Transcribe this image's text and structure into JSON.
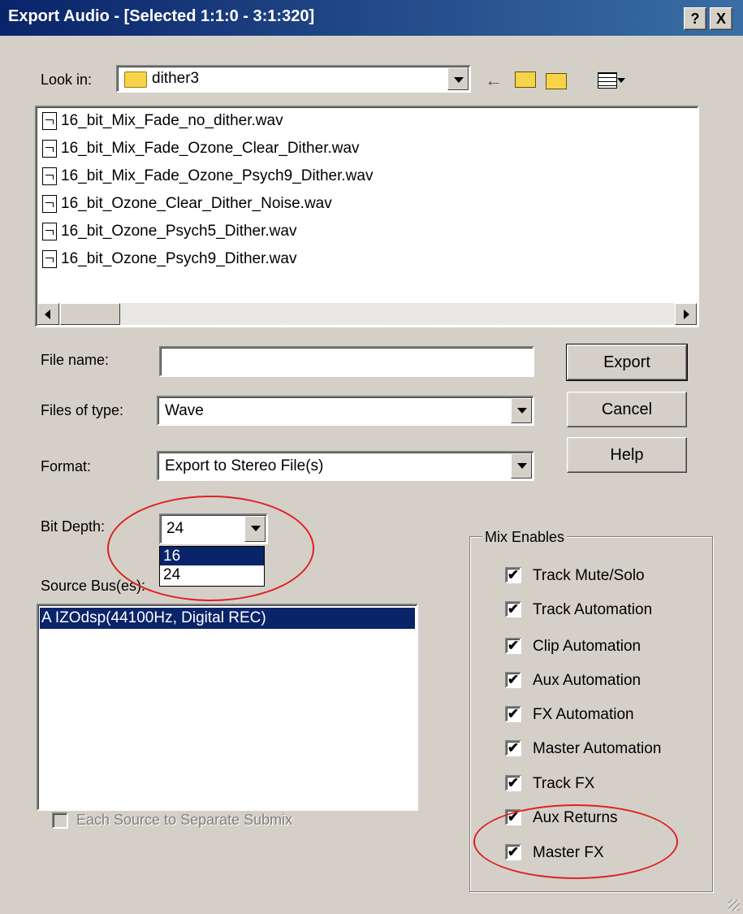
{
  "window": {
    "title": "Export Audio - [Selected 1:1:0 - 3:1:320]",
    "help_btn": "?",
    "close_btn": "X"
  },
  "look_in": {
    "label": "Look in:",
    "value": "dither3"
  },
  "files": [
    "16_bit_Mix_Fade_no_dither.wav",
    "16_bit_Mix_Fade_Ozone_Clear_Dither.wav",
    "16_bit_Mix_Fade_Ozone_Psych9_Dither.wav",
    "16_bit_Ozone_Clear_Dither_Noise.wav",
    "16_bit_Ozone_Psych5_Dither.wav",
    "16_bit_Ozone_Psych9_Dither.wav"
  ],
  "file_name": {
    "label": "File name:",
    "value": ""
  },
  "files_of_type": {
    "label": "Files of type:",
    "value": "Wave"
  },
  "format": {
    "label": "Format:",
    "value": "Export to Stereo File(s)"
  },
  "bit_depth": {
    "label": "Bit Depth:",
    "value": "24",
    "options": [
      "16",
      "24"
    ]
  },
  "source_bus": {
    "label": "Source Bus(es):",
    "items": [
      "A IZOdsp(44100Hz, Digital REC)"
    ]
  },
  "separate_submix": {
    "label": "Each Source to Separate Submix"
  },
  "buttons": {
    "export": "Export",
    "cancel": "Cancel",
    "help": "Help"
  },
  "mix_enables": {
    "title": "Mix Enables",
    "items": [
      "Track Mute/Solo",
      "Track Automation",
      "Clip Automation",
      "Aux Automation",
      "FX Automation",
      "Master Automation",
      "Track FX",
      "Aux Returns",
      "Master FX"
    ],
    "check_mark": "✔"
  },
  "colors": {
    "selection": "#0a246a",
    "annotation": "#e02020",
    "dialog": "#d4d0c8"
  }
}
